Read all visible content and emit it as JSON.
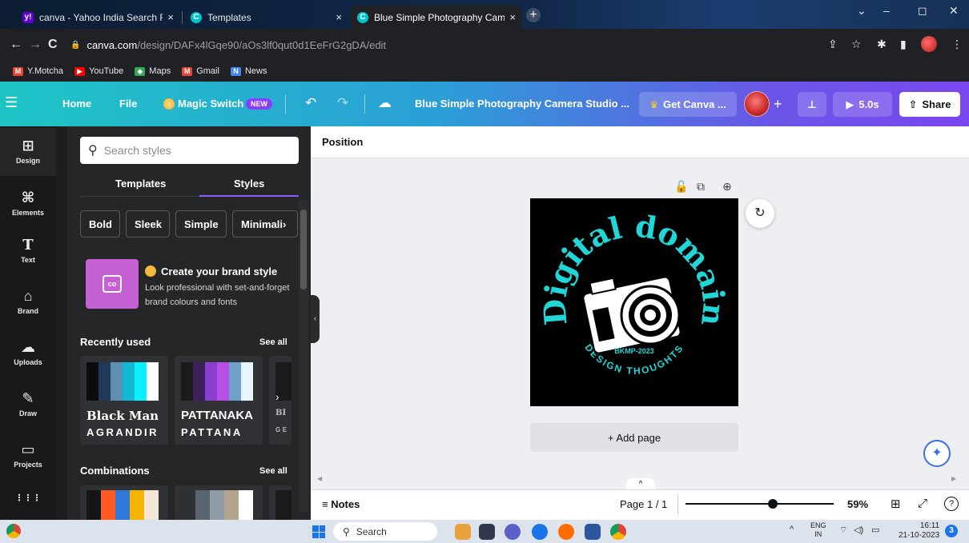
{
  "browser": {
    "tabs": [
      {
        "title": "canva - Yahoo India Search Resu",
        "close": "×"
      },
      {
        "title": "Templates",
        "close": "×"
      },
      {
        "title": "Blue Simple Photography Camer",
        "close": "×"
      }
    ],
    "new_tab": "+",
    "window_controls": {
      "list": "⌄",
      "minimize": "–",
      "restore": "◻",
      "close": "✕"
    },
    "nav": {
      "back": "←",
      "forward": "→",
      "reload": "C"
    },
    "url_host": "canva.com",
    "url_path": "/design/DAFx4lGqe90/aOs3lf0qut0d1EeFrG2gDA/edit",
    "addr_icons": {
      "share": "⇪",
      "star": "☆",
      "extensions": "✱",
      "sidepanel": "▮",
      "menu": "⋮"
    },
    "bookmarks": [
      {
        "label": "Y.Motcha",
        "icon": "M",
        "color": "#ea4335"
      },
      {
        "label": "YouTube",
        "icon": "▶",
        "color": "#ff0000"
      },
      {
        "label": "Maps",
        "icon": "◆",
        "color": "#34a853"
      },
      {
        "label": "Gmail",
        "icon": "M",
        "color": "#ea4335"
      },
      {
        "label": "News",
        "icon": "N",
        "color": "#4285f4"
      }
    ]
  },
  "canva_header": {
    "menu_icon": "☰",
    "home": "Home",
    "file": "File",
    "magic_switch": "Magic Switch",
    "new_badge": "NEW",
    "undo": "↶",
    "redo": "↷",
    "cloud": "☁",
    "design_title": "Blue Simple Photography Camera Studio ...",
    "get_canva": "Get Canva ...",
    "crown": "♛",
    "plus": "+",
    "insights": "⊥",
    "present_time": "5.0s",
    "play": "▶",
    "share_icon": "⇧",
    "share": "Share"
  },
  "rail": [
    {
      "label": "Design",
      "icon": "⊞"
    },
    {
      "label": "Elements",
      "icon": "⌘"
    },
    {
      "label": "Text",
      "icon": "T"
    },
    {
      "label": "Brand",
      "icon": "⌂"
    },
    {
      "label": "Uploads",
      "icon": "☁"
    },
    {
      "label": "Draw",
      "icon": "✎"
    },
    {
      "label": "Projects",
      "icon": "▭"
    },
    {
      "label": "",
      "icon": "⋮⋮⋮"
    }
  ],
  "panel": {
    "search_icon": "⚲",
    "search_placeholder": "Search styles",
    "tabs": [
      "Templates",
      "Styles"
    ],
    "chips": [
      "Bold",
      "Sleek",
      "Simple",
      "Minimali"
    ],
    "chip_more": "›",
    "brand_title": "Create your brand style",
    "brand_desc": "Look professional with set-and-forget brand colours and fonts",
    "brand_icon_text": "co",
    "recently_used": "Recently used",
    "see_all_1": "See all",
    "styles": [
      {
        "name": "Black Man",
        "sub": "AGRANDIR",
        "colors": [
          "#0c0c0c",
          "#1e3a57",
          "#5e8fb3",
          "#12b8d4",
          "#0af0ff",
          "#ffffff"
        ]
      },
      {
        "name": "PATTANAKA",
        "sub": "PATTANA",
        "colors": [
          "#1a1a1a",
          "#3d1f5c",
          "#8b3fd1",
          "#b84ee8",
          "#6fa1c9",
          "#e8f4ff"
        ]
      },
      {
        "name": "BI",
        "sub": "GE",
        "colors": [
          "#1a1a1a"
        ]
      }
    ],
    "carousel_next": "›",
    "combinations": "Combinations",
    "see_all_2": "See all",
    "combos": [
      {
        "colors": [
          "#151515",
          "#ff5a1f",
          "#2f78d8",
          "#f4b400",
          "#f3e6d6"
        ]
      },
      {
        "colors": [
          "#2d3135",
          "#586470",
          "#8f9ca5",
          "#b4a58e",
          "#ffffff"
        ]
      },
      {
        "colors": [
          "#1a1a1a"
        ]
      }
    ],
    "collapse": "‹"
  },
  "editor": {
    "context_label": "Position",
    "page_tools": {
      "lock": "🔓",
      "duplicate": "⧉",
      "add": "⊕"
    },
    "regen_icon": "↻",
    "add_page": "+ Add page",
    "magic_fab": "✦",
    "canvas_logo": {
      "title": "Digital domain",
      "tag": "BKMP-2023",
      "subtitle": "DESIGN THOUGHTS",
      "accent": "#20d6d6"
    }
  },
  "footer": {
    "caret": "^",
    "notes_icon": "≡",
    "notes": "Notes",
    "page_info": "Page 1 / 1",
    "zoom_fraction": 0.59,
    "zoom": "59%",
    "grid_icon": "⊞",
    "expand_icon": "⤢",
    "help_icon": "?"
  },
  "taskbar": {
    "search_icon": "⚲",
    "search": "Search",
    "tray_chevron": "^",
    "lang1": "ENG",
    "lang2": "IN",
    "time": "16:11",
    "date": "21-10-2023",
    "notifications": "3",
    "apps": [
      "#e9a23b",
      "#2f3b4c",
      "#5b5fc7",
      "#1a73e8",
      "#ff6d00",
      "#2b579a",
      "#db4437"
    ]
  }
}
